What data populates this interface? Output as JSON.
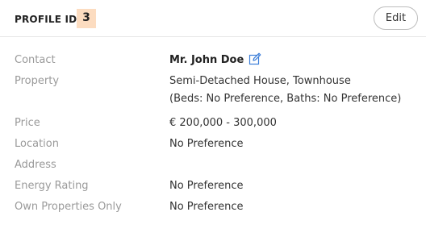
{
  "header": {
    "title": "PROFILE ID",
    "id_value": "3",
    "edit_label": "Edit"
  },
  "details": {
    "contact_label": "Contact",
    "contact_value": "Mr. John Doe",
    "property_label": "Property",
    "property_value_line1": "Semi-Detached House, Townhouse",
    "property_value_line2": "(Beds: No Preference, Baths: No Preference)",
    "price_label": "Price",
    "price_value": "€ 200,000 - 300,000",
    "location_label": "Location",
    "location_value": "No Preference",
    "address_label": "Address",
    "address_value": "",
    "energy_label": "Energy Rating",
    "energy_value": "No Preference",
    "own_label": "Own Properties Only",
    "own_value": "No Preference"
  },
  "icons": {
    "contact_edit": "pencil-square-icon"
  },
  "colors": {
    "id_badge_bg": "#fcdcc0",
    "icon_accent": "#3b7dd8",
    "label_text": "#9a9a9a"
  }
}
